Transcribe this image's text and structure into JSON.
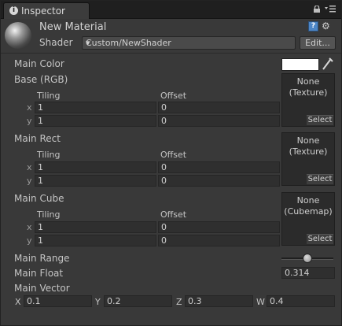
{
  "tab": {
    "label": "Inspector",
    "icon": "info-icon"
  },
  "header": {
    "material_name": "New Material",
    "shader_label": "Shader",
    "shader_value": "Custom/NewShader",
    "edit_label": "Edit...",
    "help_glyph": "?"
  },
  "main_color": {
    "label": "Main Color",
    "value": "#ffffff"
  },
  "base_rgb": {
    "label": "Base (RGB)",
    "tiling_label": "Tiling",
    "offset_label": "Offset",
    "x_label": "x",
    "y_label": "y",
    "tiling_x": "1",
    "tiling_y": "1",
    "offset_x": "0",
    "offset_y": "0",
    "texture_none": "None",
    "texture_type": "(Texture)",
    "select_label": "Select"
  },
  "main_rect": {
    "label": "Main Rect",
    "tiling_label": "Tiling",
    "offset_label": "Offset",
    "x_label": "x",
    "y_label": "y",
    "tiling_x": "1",
    "tiling_y": "1",
    "offset_x": "0",
    "offset_y": "0",
    "texture_none": "None",
    "texture_type": "(Texture)",
    "select_label": "Select"
  },
  "main_cube": {
    "label": "Main Cube",
    "tiling_label": "Tiling",
    "offset_label": "Offset",
    "x_label": "x",
    "y_label": "y",
    "tiling_x": "1",
    "tiling_y": "1",
    "offset_x": "0",
    "offset_y": "0",
    "texture_none": "None",
    "texture_type": "(Cubemap)",
    "select_label": "Select"
  },
  "main_range": {
    "label": "Main Range",
    "fraction": 0.5
  },
  "main_float": {
    "label": "Main Float",
    "value": "0.314"
  },
  "main_vector": {
    "label": "Main Vector",
    "x_label": "X",
    "x_value": "0.1",
    "y_label": "Y",
    "y_value": "0.2",
    "z_label": "Z",
    "z_value": "0.3",
    "w_label": "W",
    "w_value": "0.4"
  }
}
